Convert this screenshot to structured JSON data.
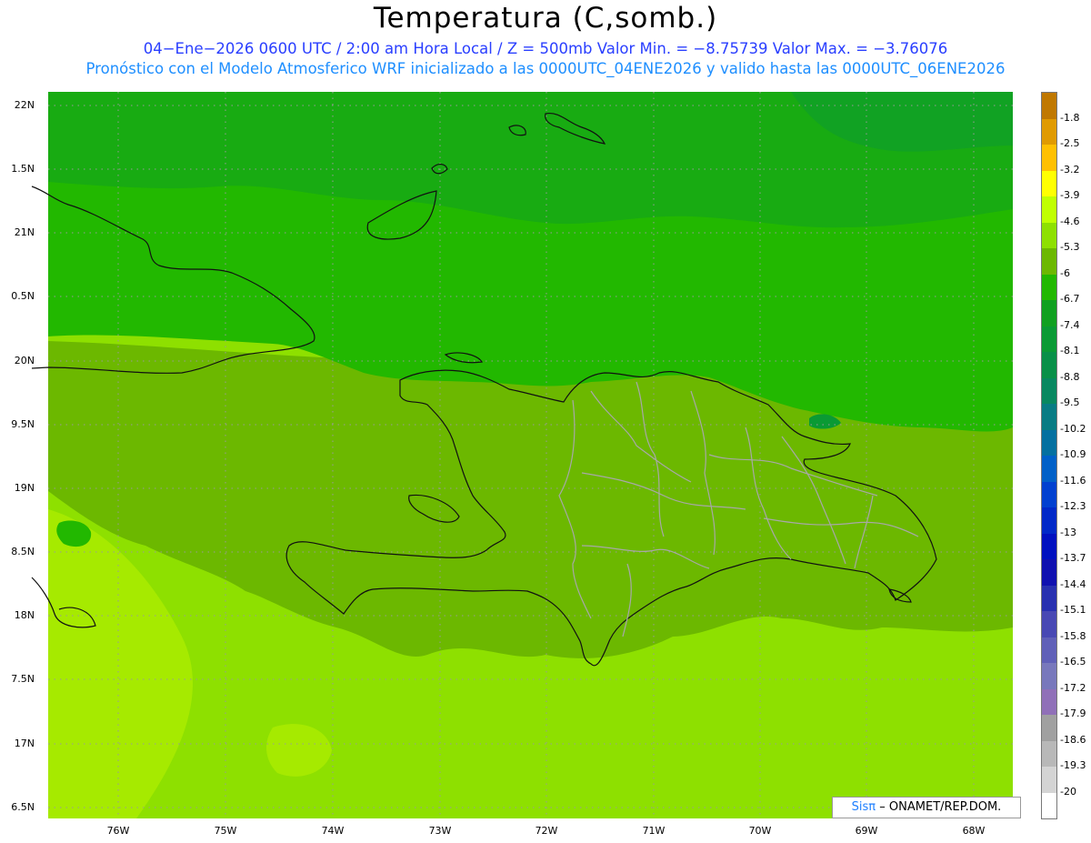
{
  "title": "Temperatura (C,somb.)",
  "subtitle_1": "04−Ene−2026   0600 UTC  /  2:00 am  Hora Local  /  Z = 500mb   Valor Min. = −8.75739   Valor Max. = −3.76076",
  "subtitle_2": "Pronóstico con el Modelo Atmosferico WRF inicializado a las 0000UTC_04ENE2026 y valido hasta las  0000UTC_06ENE2026",
  "lat_labels": [
    "22N",
    "1.5N",
    "21N",
    "0.5N",
    "20N",
    "9.5N",
    "19N",
    "8.5N",
    "18N",
    "7.5N",
    "17N",
    "6.5N"
  ],
  "lon_labels": [
    "76W",
    "75W",
    "74W",
    "73W",
    "72W",
    "71W",
    "70W",
    "69W",
    "68W"
  ],
  "colorbar": {
    "labels": [
      "-1.8",
      "-2.5",
      "-3.2",
      "-3.9",
      "-4.6",
      "-5.3",
      "-6",
      "-6.7",
      "-7.4",
      "-8.1",
      "-8.8",
      "-9.5",
      "-10.2",
      "-10.9",
      "-11.6",
      "-12.3",
      "-13",
      "-13.7",
      "-14.4",
      "-15.1",
      "-15.8",
      "-16.5",
      "-17.2",
      "-17.9",
      "-18.6",
      "-19.3",
      "-20"
    ],
    "colors": [
      "#c07800",
      "#e09a00",
      "#ffc000",
      "#ffff00",
      "#c0ff00",
      "#8ee000",
      "#6cb800",
      "#22b800",
      "#10a020",
      "#0a9a34",
      "#089048",
      "#088860",
      "#087c84",
      "#0470a0",
      "#0060c8",
      "#0040d0",
      "#0028c8",
      "#0010c0",
      "#1010b0",
      "#2830b0",
      "#4848b4",
      "#6060b8",
      "#7878bc",
      "#9070b8",
      "#a0a0a0",
      "#b8b8b8",
      "#d4d4d4",
      "#ffffff"
    ]
  },
  "credit": {
    "brand": "Sisπ",
    "text": "– ONAMET/REP.DOM."
  },
  "field_colors": {
    "band_n": "#10a020",
    "band_n2": "#22b800",
    "band_mid": "#6cb800",
    "band_s": "#8ee000",
    "band_ss": "#a0e800",
    "pale": "#b4f000"
  }
}
